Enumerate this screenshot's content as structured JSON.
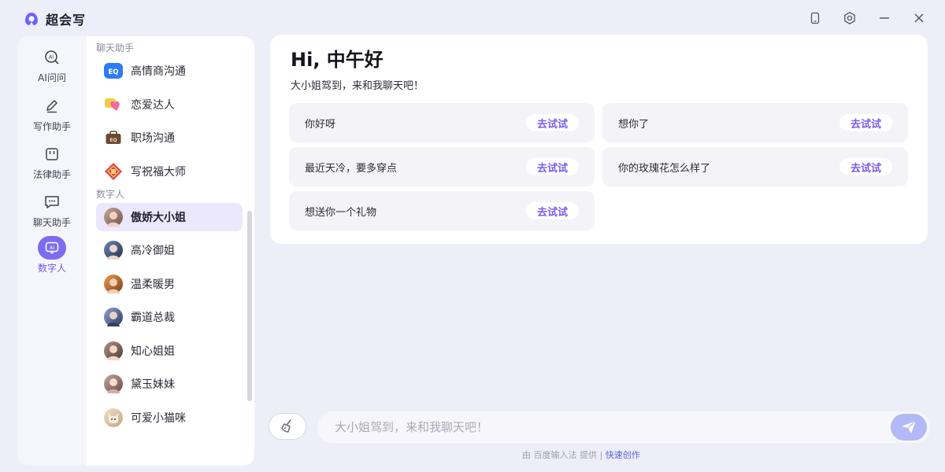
{
  "app": {
    "title": "超会写"
  },
  "nav": [
    {
      "label": "AI问问",
      "icon": "ai-ask-icon"
    },
    {
      "label": "写作助手",
      "icon": "pen-icon"
    },
    {
      "label": "法律助手",
      "icon": "law-icon"
    },
    {
      "label": "聊天助手",
      "icon": "chat-icon"
    },
    {
      "label": "数字人",
      "icon": "digital-human-icon",
      "active": true
    }
  ],
  "chat_assistant": {
    "title": "聊天助手",
    "items": [
      {
        "label": "高情商沟通",
        "icon": "eq-bubble-icon"
      },
      {
        "label": "恋爱达人",
        "icon": "heart-icon"
      },
      {
        "label": "职场沟通",
        "icon": "briefcase-icon"
      },
      {
        "label": "写祝福大师",
        "icon": "blessing-icon"
      }
    ]
  },
  "digital_human": {
    "title": "数字人",
    "items": [
      {
        "label": "傲娇大小姐",
        "selected": true
      },
      {
        "label": "高冷御姐"
      },
      {
        "label": "温柔暖男"
      },
      {
        "label": "霸道总裁"
      },
      {
        "label": "知心姐姐"
      },
      {
        "label": "黛玉妹妹"
      },
      {
        "label": "可爱小猫咪"
      }
    ]
  },
  "main": {
    "greeting": "Hi, 中午好",
    "subtitle": "大小姐驾到，来和我聊天吧！",
    "suggestions": [
      {
        "text": "你好呀",
        "button": "去试试"
      },
      {
        "text": "想你了",
        "button": "去试试"
      },
      {
        "text": "最近天冷，要多穿点",
        "button": "去试试"
      },
      {
        "text": "你的玫瑰花怎么样了",
        "button": "去试试"
      },
      {
        "text": "想送你一个礼物",
        "button": "去试试"
      }
    ]
  },
  "input": {
    "placeholder": "大小姐驾到，来和我聊天吧！"
  },
  "footer": {
    "prefix": "由 百度输入法 提供 |",
    "link": "快速创作"
  },
  "colors": {
    "accent": "#7b6cf0",
    "accent_text": "#7b5cf0",
    "selected_bg": "#ebe7fd",
    "send": "#b3b9f6"
  }
}
